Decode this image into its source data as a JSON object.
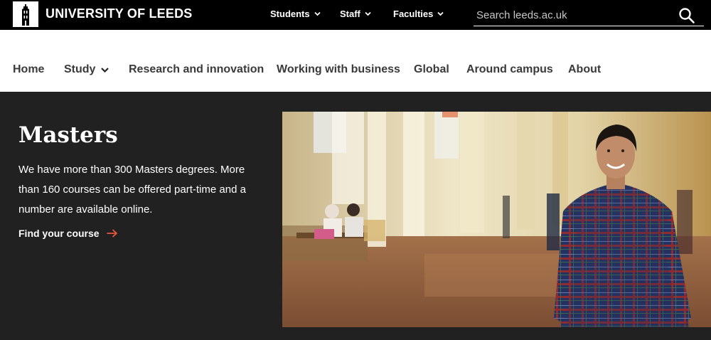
{
  "header": {
    "brand": "UNIVERSITY OF LEEDS",
    "nav": [
      {
        "label": "Students"
      },
      {
        "label": "Staff"
      },
      {
        "label": "Faculties"
      }
    ],
    "search": {
      "placeholder": "Search leeds.ac.uk",
      "value": ""
    }
  },
  "main_nav": {
    "items": [
      {
        "label": "Home"
      },
      {
        "label": "Study"
      },
      {
        "label": "Research and innovation"
      },
      {
        "label": "Working with business"
      },
      {
        "label": "Global"
      },
      {
        "label": "Around campus"
      },
      {
        "label": "About"
      }
    ]
  },
  "hero": {
    "title": "Masters",
    "text": "We have more than 300 Masters degrees. More than 160 courses can be offered part-time and a number are available online.",
    "link_label": "Find your course",
    "accent_color": "#e8563b"
  },
  "icons": {
    "logo": "university-tower-logo-icon",
    "search": "search-icon",
    "chevron": "chevron-down-icon",
    "arrow": "arrow-right-icon"
  }
}
